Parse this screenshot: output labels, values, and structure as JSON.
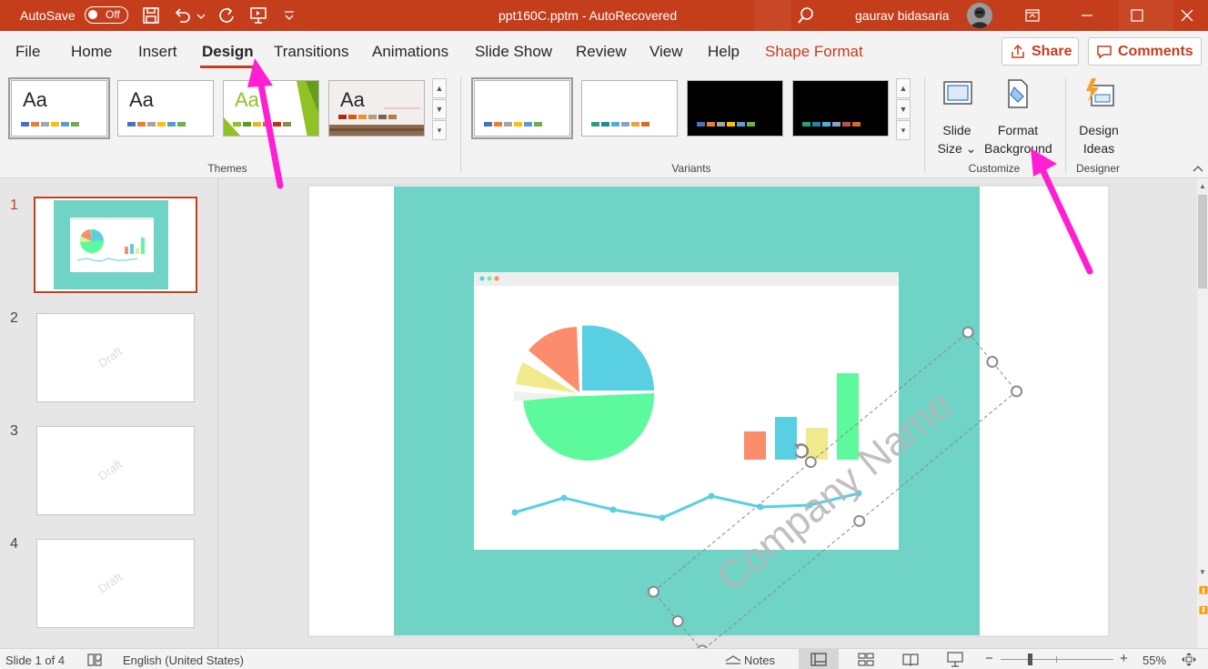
{
  "title_bar": {
    "autosave_label": "AutoSave",
    "autosave_state": "Off",
    "document_title": "ppt160C.pptm  -  AutoRecovered",
    "user_name": "gaurav bidasaria"
  },
  "tabs": [
    "File",
    "Home",
    "Insert",
    "Design",
    "Transitions",
    "Animations",
    "Slide Show",
    "Review",
    "View",
    "Help",
    "Shape Format"
  ],
  "active_tab": "Design",
  "share_label": "Share",
  "comments_label": "Comments",
  "ribbon": {
    "themes_group": "Themes",
    "theme_text": "Aa",
    "variants_group": "Variants",
    "customize_group": "Customize",
    "designer_group": "Designer",
    "slide_size_line1": "Slide",
    "slide_size_line2": "Size",
    "format_bg_line1": "Format",
    "format_bg_line2": "Background",
    "design_ideas_line1": "Design",
    "design_ideas_line2": "Ideas"
  },
  "slides": {
    "numbers": [
      "1",
      "2",
      "3",
      "4"
    ],
    "watermark": "Draft",
    "current": 1
  },
  "slide_content": {
    "watermark_text": "Company Name"
  },
  "status_bar": {
    "slide_counter": "Slide 1 of 4",
    "language": "English (United States)",
    "notes_label": "Notes",
    "zoom": "55%"
  },
  "colors": {
    "accent": "#c43e1c",
    "slide_teal": "#6fd3c6",
    "annotation_arrow": "#ff1fd2"
  }
}
